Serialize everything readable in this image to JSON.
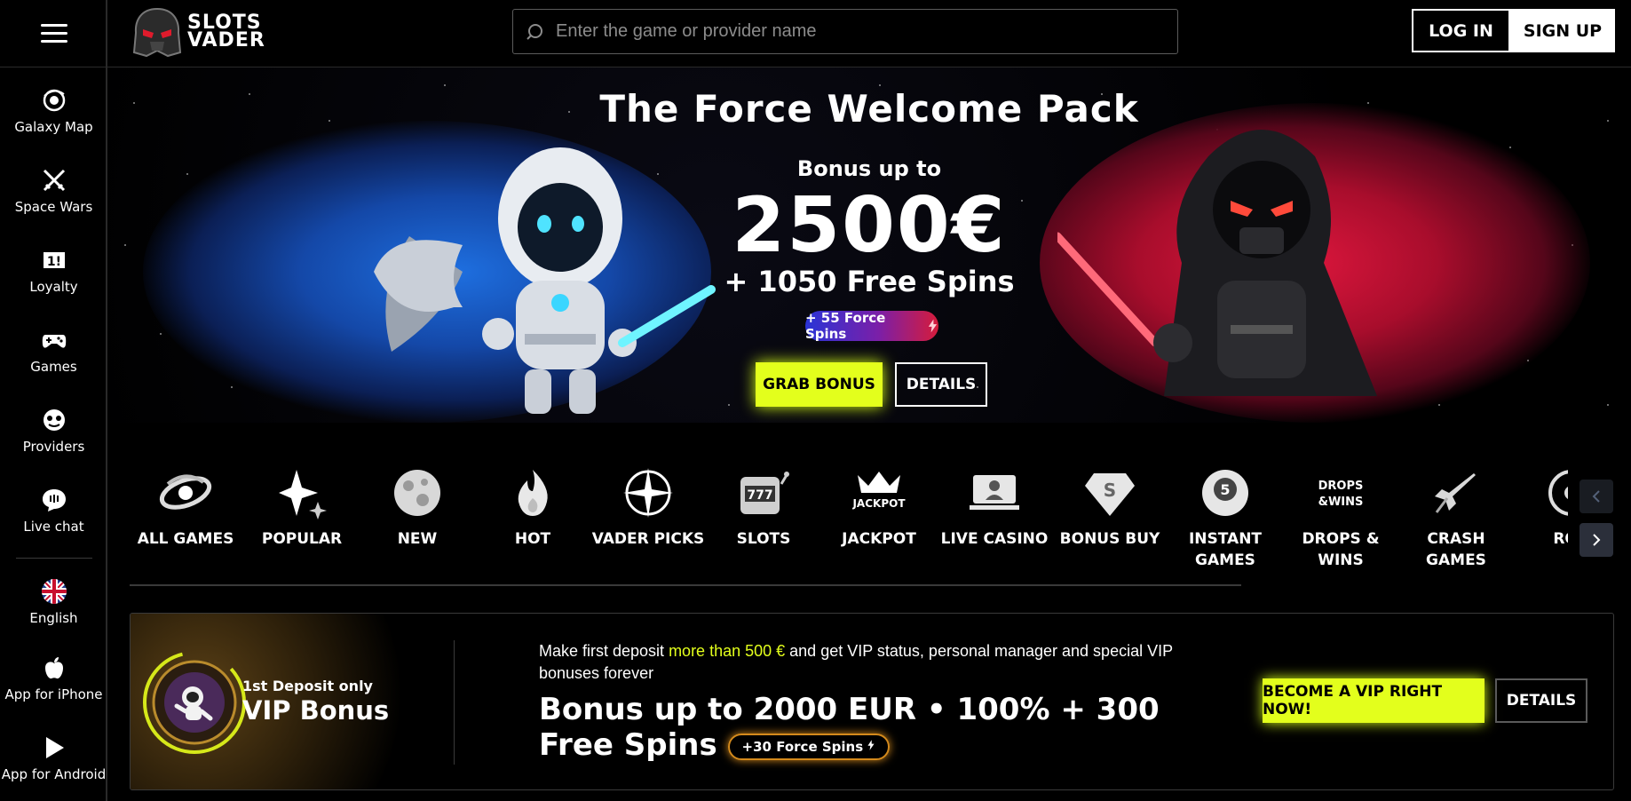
{
  "header": {
    "logo_line1": "SLOTS",
    "logo_line2": "VADER",
    "search_placeholder": "Enter the game or provider name",
    "login_label": "LOG IN",
    "signup_label": "SIGN UP"
  },
  "sidebar": {
    "items": [
      {
        "label": "Galaxy Map",
        "icon": "galaxy-icon"
      },
      {
        "label": "Space Wars",
        "icon": "swords-icon"
      },
      {
        "label": "Loyalty",
        "icon": "loyalty-icon"
      },
      {
        "label": "Games",
        "icon": "gamepad-icon"
      },
      {
        "label": "Providers",
        "icon": "providers-icon"
      },
      {
        "label": "Live chat",
        "icon": "chat-icon"
      }
    ],
    "lower": [
      {
        "label": "English",
        "icon": "uk-flag-icon"
      },
      {
        "label": "App for iPhone",
        "icon": "apple-icon"
      },
      {
        "label": "App for Android",
        "icon": "play-icon"
      }
    ]
  },
  "hero": {
    "title": "The Force Welcome Pack",
    "subtitle": "Bonus up to",
    "amount": "2500€",
    "spins": "+ 1050 Free Spins",
    "force_pill": "+ 55 Force Spins",
    "grab_label": "GRAB BONUS",
    "details_label": "DETAILS"
  },
  "categories": [
    {
      "label": "ALL GAMES",
      "icon": "galaxy-swirl-icon"
    },
    {
      "label": "POPULAR",
      "icon": "sparkle-icon"
    },
    {
      "label": "NEW",
      "icon": "moon-icon"
    },
    {
      "label": "HOT",
      "icon": "flame-icon"
    },
    {
      "label": "VADER PICKS",
      "icon": "compass-star-icon"
    },
    {
      "label": "SLOTS",
      "icon": "slot-machine-icon"
    },
    {
      "label": "JACKPOT",
      "icon": "jackpot-crown-icon"
    },
    {
      "label": "LIVE CASINO",
      "icon": "live-dealer-icon"
    },
    {
      "label": "BONUS BUY",
      "icon": "diamond-s-icon"
    },
    {
      "label": "INSTANT GAMES",
      "icon": "ball-five-icon"
    },
    {
      "label": "DROPS & WINS",
      "icon": "drops-wins-icon"
    },
    {
      "label": "CRASH GAMES",
      "icon": "spaceship-icon"
    },
    {
      "label": "ROU",
      "icon": "roulette-icon"
    }
  ],
  "vip": {
    "small": "1st Deposit only",
    "big": "VIP Bonus",
    "desc_pre": "Make first deposit ",
    "desc_hl": "more than 500 €",
    "desc_post": " and get VIP status, personal manager and special VIP bonuses forever",
    "title": "Bonus up to 2000 EUR • 100% + 300 Free Spins",
    "pill": "+30 Force Spins",
    "cta_label": "BECOME A VIP RIGHT NOW!",
    "details_label": "DETAILS"
  },
  "colors": {
    "accent": "#e3ff1c",
    "blue_glow": "#1e6fe0",
    "red_glow": "#e0173e"
  }
}
